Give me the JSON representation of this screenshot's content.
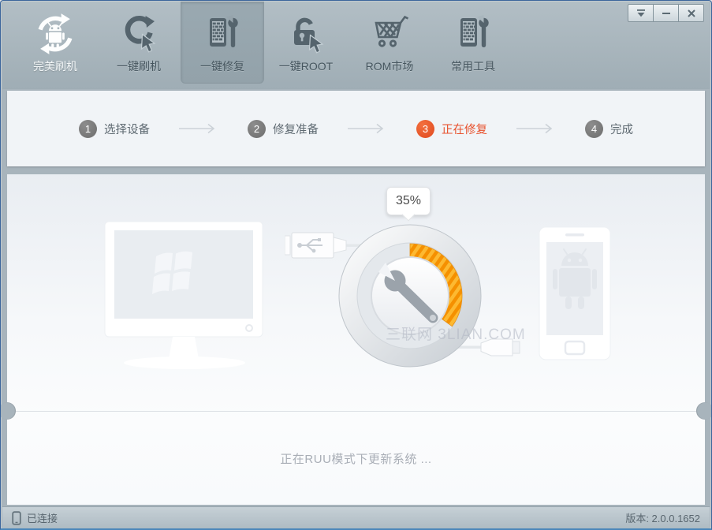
{
  "window": {
    "app_title": "完美刷机",
    "controls": {
      "skin": "skin-menu",
      "minimize": "minimize",
      "close": "close"
    }
  },
  "toolbar": {
    "items": [
      {
        "label": "完美刷机",
        "icon": "android-refresh-logo-icon",
        "active": false
      },
      {
        "label": "一键刷机",
        "icon": "one-key-flash-icon",
        "active": false
      },
      {
        "label": "一键修复",
        "icon": "one-key-repair-icon",
        "active": true
      },
      {
        "label": "一键ROOT",
        "icon": "one-key-root-icon",
        "active": false
      },
      {
        "label": "ROM市场",
        "icon": "rom-market-cart-icon",
        "active": false
      },
      {
        "label": "常用工具",
        "icon": "common-tools-icon",
        "active": false
      }
    ]
  },
  "steps": [
    {
      "number": "1",
      "label": "选择设备",
      "active": false
    },
    {
      "number": "2",
      "label": "修复准备",
      "active": false
    },
    {
      "number": "3",
      "label": "正在修复",
      "active": true
    },
    {
      "number": "4",
      "label": "完成",
      "active": false
    }
  ],
  "progress": {
    "percent": "35%",
    "status_message": "正在RUU模式下更新系统 ..."
  },
  "watermark": "三联网 3LIAN.COM",
  "statusbar": {
    "connection_status": "已连接",
    "version": "版本: 2.0.0.1652"
  },
  "colors": {
    "progress_orange": "#f59000",
    "progress_orange_light": "#fdb931",
    "step_active_red": "#e8512d",
    "frame_gray_blue": "#a8b4bc"
  }
}
